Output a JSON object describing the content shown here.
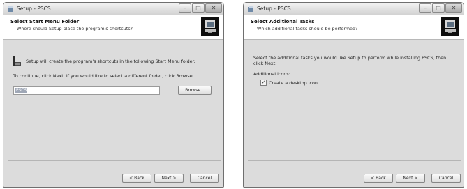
{
  "window1": {
    "title": "Setup - PSCS",
    "header_title": "Select Start Menu Folder",
    "header_subtitle": "Where should Setup place the program's shortcuts?",
    "info_text": "Setup will create the program's shortcuts in the following Start Menu folder.",
    "instruction": "To continue, click Next. If you would like to select a different folder, click Browse.",
    "folder_value": "PSCS",
    "browse_label": "Browse...",
    "back_label": "< Back",
    "next_label": "Next >",
    "cancel_label": "Cancel"
  },
  "window2": {
    "title": "Setup - PSCS",
    "header_title": "Select Additional Tasks",
    "header_subtitle": "Which additional tasks should be performed?",
    "instruction_line1": "Select the additional tasks you would like Setup to perform while installing PSCS, then",
    "instruction_line2": "click Next.",
    "group_label": "Additional icons:",
    "checkbox_label": "Create a desktop icon",
    "checkbox_checked": true,
    "back_label": "< Back",
    "next_label": "Next >",
    "cancel_label": "Cancel"
  },
  "icons": {
    "app": "setup-app-icon",
    "folder": "start-menu-folder-icon",
    "header": "installer-computer-icon",
    "minimize": "minimize-icon",
    "maximize": "maximize-icon",
    "close": "close-icon"
  }
}
